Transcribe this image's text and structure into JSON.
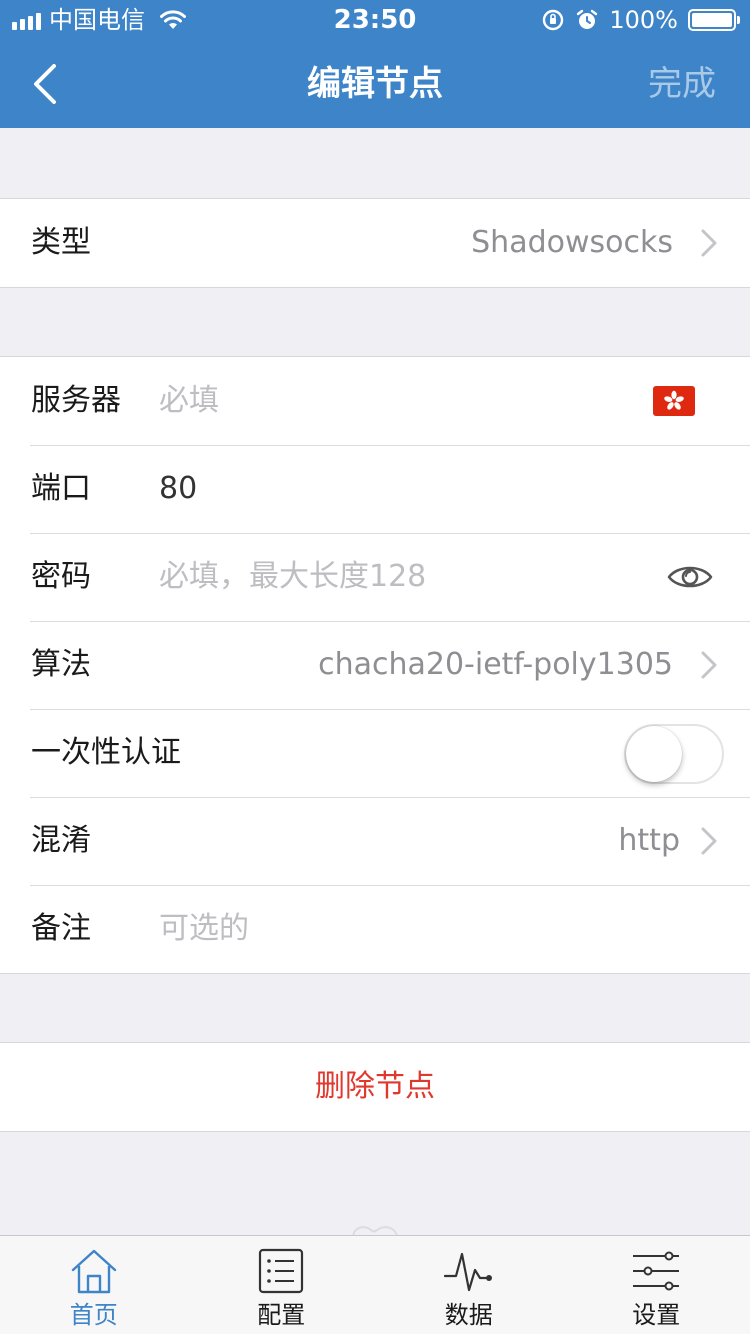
{
  "status_bar": {
    "carrier": "中国电信",
    "time": "23:50",
    "battery": "100%"
  },
  "nav": {
    "title": "编辑节点",
    "done_label": "完成"
  },
  "type_row": {
    "label": "类型",
    "value": "Shadowsocks"
  },
  "fields": {
    "server": {
      "label": "服务器",
      "placeholder": "必填"
    },
    "port": {
      "label": "端口",
      "value": "80"
    },
    "password": {
      "label": "密码",
      "placeholder": "必填，最大长度128"
    },
    "algorithm": {
      "label": "算法",
      "value": "chacha20-ietf-poly1305"
    },
    "one_time_auth": {
      "label": "一次性认证",
      "enabled": false
    },
    "obfs": {
      "label": "混淆",
      "value": "http"
    },
    "note": {
      "label": "备注",
      "placeholder": "可选的"
    }
  },
  "delete_label": "删除节点",
  "tabs": [
    {
      "label": "首页",
      "icon": "home-icon",
      "active": true
    },
    {
      "label": "配置",
      "icon": "list-icon",
      "active": false
    },
    {
      "label": "数据",
      "icon": "pulse-icon",
      "active": false
    },
    {
      "label": "设置",
      "icon": "sliders-icon",
      "active": false
    }
  ],
  "colors": {
    "nav_bg": "#3e84c8",
    "delete": "#e0382d",
    "active_tab": "#3e84c8",
    "flag": "#de2910"
  }
}
